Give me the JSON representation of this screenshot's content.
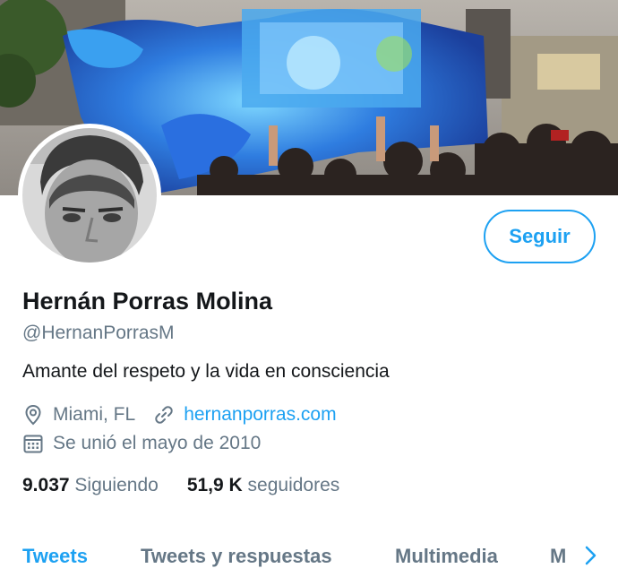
{
  "profile": {
    "name": "Hernán Porras Molina",
    "handle": "@HernanPorrasM",
    "bio": "Amante del respeto y la vida en consciencia",
    "location": "Miami, FL",
    "website": "hernanporras.com",
    "joined": "Se unió el mayo de 2010",
    "follow_label": "Seguir"
  },
  "stats": {
    "following_count": "9.037",
    "following_label": "Siguiendo",
    "followers_count": "51,9 K",
    "followers_label": "seguidores"
  },
  "tabs": [
    {
      "label": "Tweets",
      "active": true
    },
    {
      "label": "Tweets y respuestas",
      "active": false
    },
    {
      "label": "Multimedia",
      "active": false
    },
    {
      "label": "M",
      "active": false
    }
  ],
  "icons": {
    "location": "location-pin-icon",
    "link": "link-icon",
    "calendar": "calendar-icon",
    "chevron": "chevron-right-icon"
  },
  "colors": {
    "accent": "#1da1f2",
    "secondary_text": "#657786",
    "primary_text": "#14171a"
  }
}
